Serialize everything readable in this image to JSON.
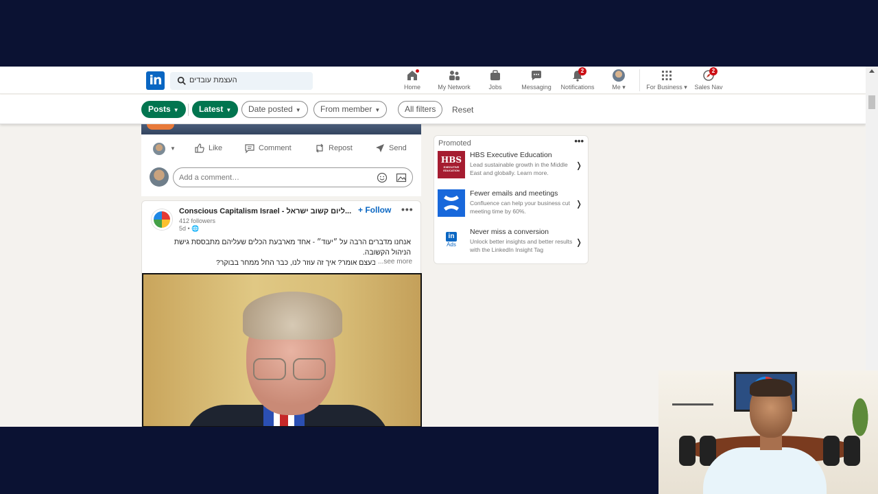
{
  "nav": {
    "logo": "in",
    "search_value": "העצמת עובדים",
    "items": [
      {
        "label": "Home",
        "badge": ""
      },
      {
        "label": "My Network",
        "badge": ""
      },
      {
        "label": "Jobs",
        "badge": ""
      },
      {
        "label": "Messaging",
        "badge": ""
      },
      {
        "label": "Notifications",
        "badge": "2"
      },
      {
        "label": "Me",
        "badge": ""
      },
      {
        "label": "For Business",
        "badge": ""
      },
      {
        "label": "Sales Nav",
        "badge": "2"
      }
    ]
  },
  "filters": {
    "posts": "Posts",
    "latest": "Latest",
    "date_posted": "Date posted",
    "from_member": "From member",
    "all_filters": "All filters",
    "reset": "Reset"
  },
  "actions": {
    "like": "Like",
    "comment": "Comment",
    "repost": "Repost",
    "send": "Send",
    "comment_placeholder": "Add a comment…"
  },
  "post": {
    "author": "Conscious Capitalism Israel - ליום קשוב ישראל...",
    "followers": "412 followers",
    "time": "5d •",
    "follow": "+ Follow",
    "text_lines": [
      "אנחנו מדברים הרבה על ״יעוד״ - אחד מארבעת הכלים שעליהם מתבססת גישת",
      "הניהול הקשובה.",
      "אבל מה זה בעצם אומר? איך זה עוזר לנו, כבר החל ממחר בבוקר?"
    ],
    "see_more": "...see more"
  },
  "promoted": {
    "title": "Promoted",
    "ads": [
      {
        "title": "HBS Executive Education",
        "desc": "Lead sustainable growth in the Middle East and globally. Learn more.",
        "logo": "HBS",
        "logo_sub": "EXECUTIVE EDUCATION"
      },
      {
        "title": "Fewer emails and meetings",
        "desc": "Confluence can help your business cut meeting time by 60%.",
        "logo": "confluence-icon"
      },
      {
        "title": "Never miss a conversion",
        "desc": "Unlock better insights and better results with the LinkedIn Insight Tag",
        "logo": "in",
        "logo_sub": "Ads"
      }
    ]
  },
  "colors": {
    "brand": "#0a66c2",
    "green_pill": "#01754f",
    "badge": "#cc1016",
    "frame": "#0b1233"
  }
}
